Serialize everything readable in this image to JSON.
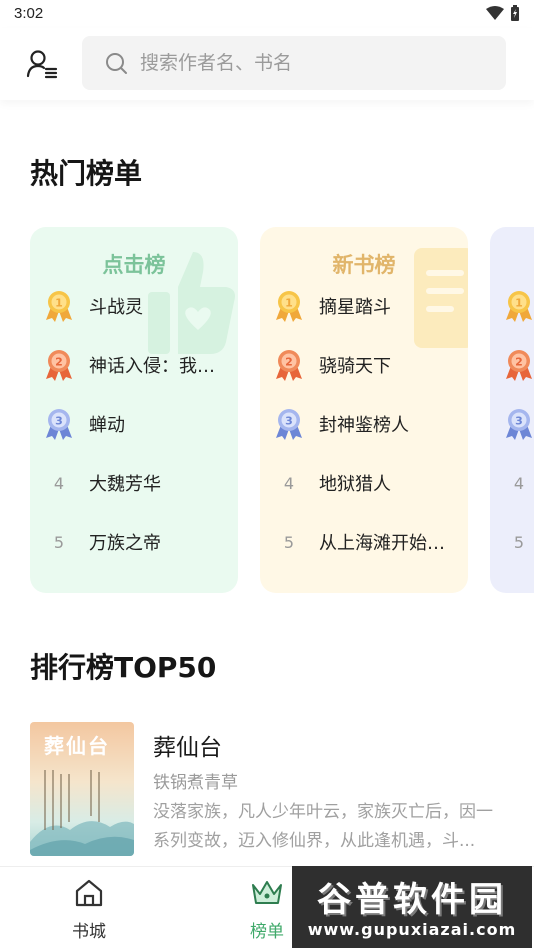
{
  "status_bar": {
    "time": "3:02"
  },
  "header": {
    "search_placeholder": "搜索作者名、书名"
  },
  "hot_section": {
    "title": "热门榜单",
    "cards": [
      {
        "title": "点击榜",
        "title_color": "#7cc39a",
        "bg": "#eafaf0",
        "items": [
          {
            "rank": "1",
            "name": "斗战灵"
          },
          {
            "rank": "2",
            "name": "神话入侵：我以奇幻为骨"
          },
          {
            "rank": "3",
            "name": "蝉动"
          },
          {
            "rank": "4",
            "name": "大魏芳华"
          },
          {
            "rank": "5",
            "name": "万族之帝"
          }
        ]
      },
      {
        "title": "新书榜",
        "title_color": "#e1b56a",
        "bg": "#fff8e6",
        "items": [
          {
            "rank": "1",
            "name": "摘星踏斗"
          },
          {
            "rank": "2",
            "name": "骁骑天下"
          },
          {
            "rank": "3",
            "name": "封神鉴榜人"
          },
          {
            "rank": "4",
            "name": "地狱猎人"
          },
          {
            "rank": "5",
            "name": "从上海滩开始崛起"
          }
        ]
      },
      {
        "title": "",
        "title_color": "#8c99d8",
        "bg": "#eceefb",
        "items": [
          {
            "rank": "1",
            "name": ""
          },
          {
            "rank": "2",
            "name": ""
          },
          {
            "rank": "3",
            "name": ""
          },
          {
            "rank": "4",
            "name": ""
          },
          {
            "rank": "5",
            "name": ""
          }
        ]
      }
    ]
  },
  "top50_section": {
    "title": "排行榜TOP50",
    "book": {
      "cover_title": "葬仙台",
      "title": "葬仙台",
      "author": "铁锅煮青草",
      "description": "没落家族，凡人少年叶云，家族灭亡后，因一系列变故，迈入修仙界，从此逢机遇，斗..."
    }
  },
  "tabbar": {
    "tabs": [
      {
        "label": "书城",
        "icon": "home-icon",
        "active": false
      },
      {
        "label": "榜单",
        "icon": "crown-icon",
        "active": true
      }
    ],
    "active_color": "#3fa96a"
  },
  "watermark": {
    "main": "谷普软件园",
    "sub": "www.gupuxiazai.com"
  }
}
